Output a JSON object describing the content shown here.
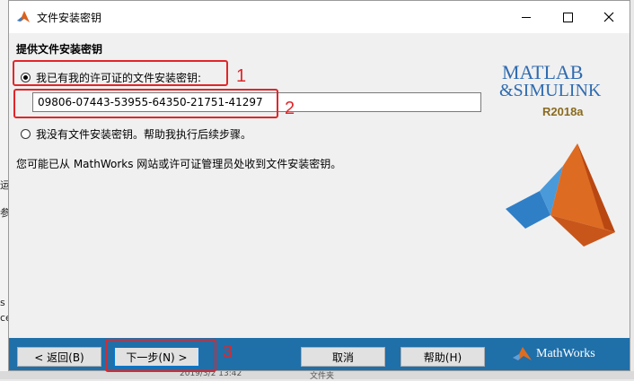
{
  "window": {
    "title": "文件安装密钥"
  },
  "section_title": "提供文件安装密钥",
  "options": {
    "have_key_label": "我已有我的许可证的文件安装密钥:",
    "no_key_label": "我没有文件安装密钥。帮助我执行后续步骤。"
  },
  "key_input": {
    "value": "09806-07443-53955-64350-21751-41297"
  },
  "info_text": "您可能已从 MathWorks 网站或许可证管理员处收到文件安装密钥。",
  "logo": {
    "line1": "MATLAB",
    "line2": "&SIMULINK",
    "release": "R2018a"
  },
  "buttons": {
    "back": "< 返回(B)",
    "next": "下一步(N) >",
    "cancel": "取消",
    "help": "帮助(H)"
  },
  "footer_brand": "MathWorks",
  "annotations": {
    "n1": "1",
    "n2": "2",
    "n3": "3"
  },
  "background": {
    "left_chars": [
      "运",
      "参",
      "s",
      "ce"
    ],
    "bottom_texts": [
      "2019/3/2 13:42",
      "文件夹"
    ]
  },
  "colors": {
    "annotation": "#e1262a",
    "footer": "#1f6fa9",
    "matlab_blue": "#2f6bb0"
  }
}
